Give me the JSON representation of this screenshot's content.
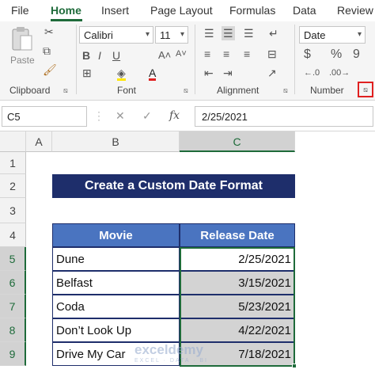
{
  "tabs": [
    "File",
    "Home",
    "Insert",
    "Page Layout",
    "Formulas",
    "Data",
    "Review"
  ],
  "ribbon": {
    "clipboard": {
      "paste_label": "Paste",
      "group_label": "Clipboard"
    },
    "font": {
      "font_name": "Calibri",
      "font_size": "11",
      "group_label": "Font"
    },
    "alignment": {
      "group_label": "Alignment"
    },
    "number": {
      "format": "Date",
      "group_label": "Number",
      "currency": "$",
      "percent": "%",
      "comma": "9"
    }
  },
  "formula_bar": {
    "name_box": "C5",
    "formula": "2/25/2021"
  },
  "grid": {
    "columns": [
      "A",
      "B",
      "C"
    ],
    "rows": [
      "1",
      "2",
      "3",
      "4",
      "5",
      "6",
      "7",
      "8",
      "9"
    ],
    "title": "Create a Custom Date Format",
    "headers": [
      "Movie",
      "Release Date"
    ],
    "data": [
      {
        "movie": "Dune",
        "date": "2/25/2021"
      },
      {
        "movie": "Belfast",
        "date": "3/15/2021"
      },
      {
        "movie": "Coda",
        "date": "5/23/2021"
      },
      {
        "movie": "Don’t Look Up",
        "date": "4/22/2021"
      },
      {
        "movie": "Drive My Car",
        "date": "7/18/2021"
      }
    ],
    "active_cell": "C5"
  },
  "watermark": {
    "name": "exceldemy",
    "tagline": "EXCEL · DATA · BI"
  },
  "colors": {
    "accent": "#1e6b3a",
    "title_bg": "#1e2e6b",
    "header_bg": "#4a74c0",
    "highlight": "#e02020"
  }
}
